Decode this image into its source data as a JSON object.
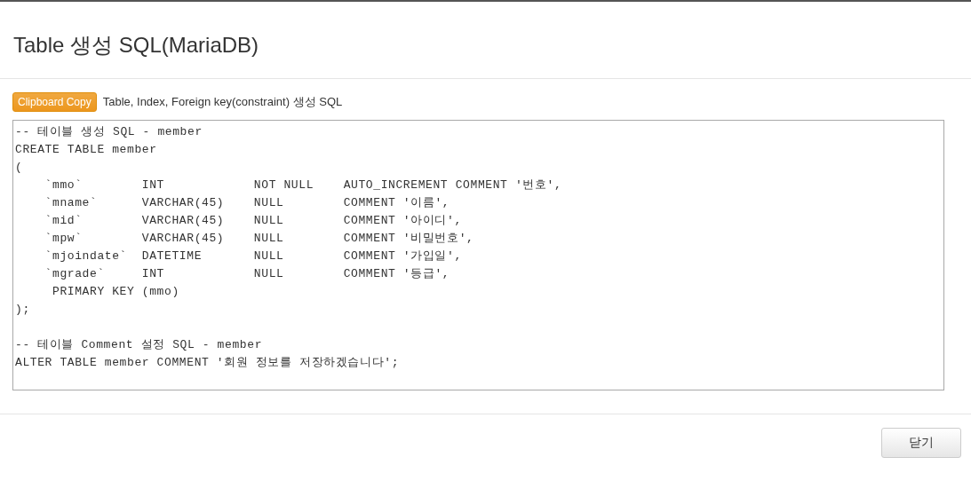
{
  "dialog": {
    "title": "Table 생성 SQL(MariaDB)",
    "copy_button": "Clipboard Copy",
    "description": "Table, Index, Foreign key(constraint) 생성 SQL",
    "sql_text": "-- 테이블 생성 SQL - member\nCREATE TABLE member\n(\n    `mmo`        INT            NOT NULL    AUTO_INCREMENT COMMENT '번호',\n    `mname`      VARCHAR(45)    NULL        COMMENT '이름',\n    `mid`        VARCHAR(45)    NULL        COMMENT '아이디',\n    `mpw`        VARCHAR(45)    NULL        COMMENT '비밀번호',\n    `mjoindate`  DATETIME       NULL        COMMENT '가입일',\n    `mgrade`     INT            NULL        COMMENT '등급',\n     PRIMARY KEY (mmo)\n);\n\n-- 테이블 Comment 설정 SQL - member\nALTER TABLE member COMMENT '회원 정보를 저장하겠습니다';",
    "close_button": "닫기"
  }
}
